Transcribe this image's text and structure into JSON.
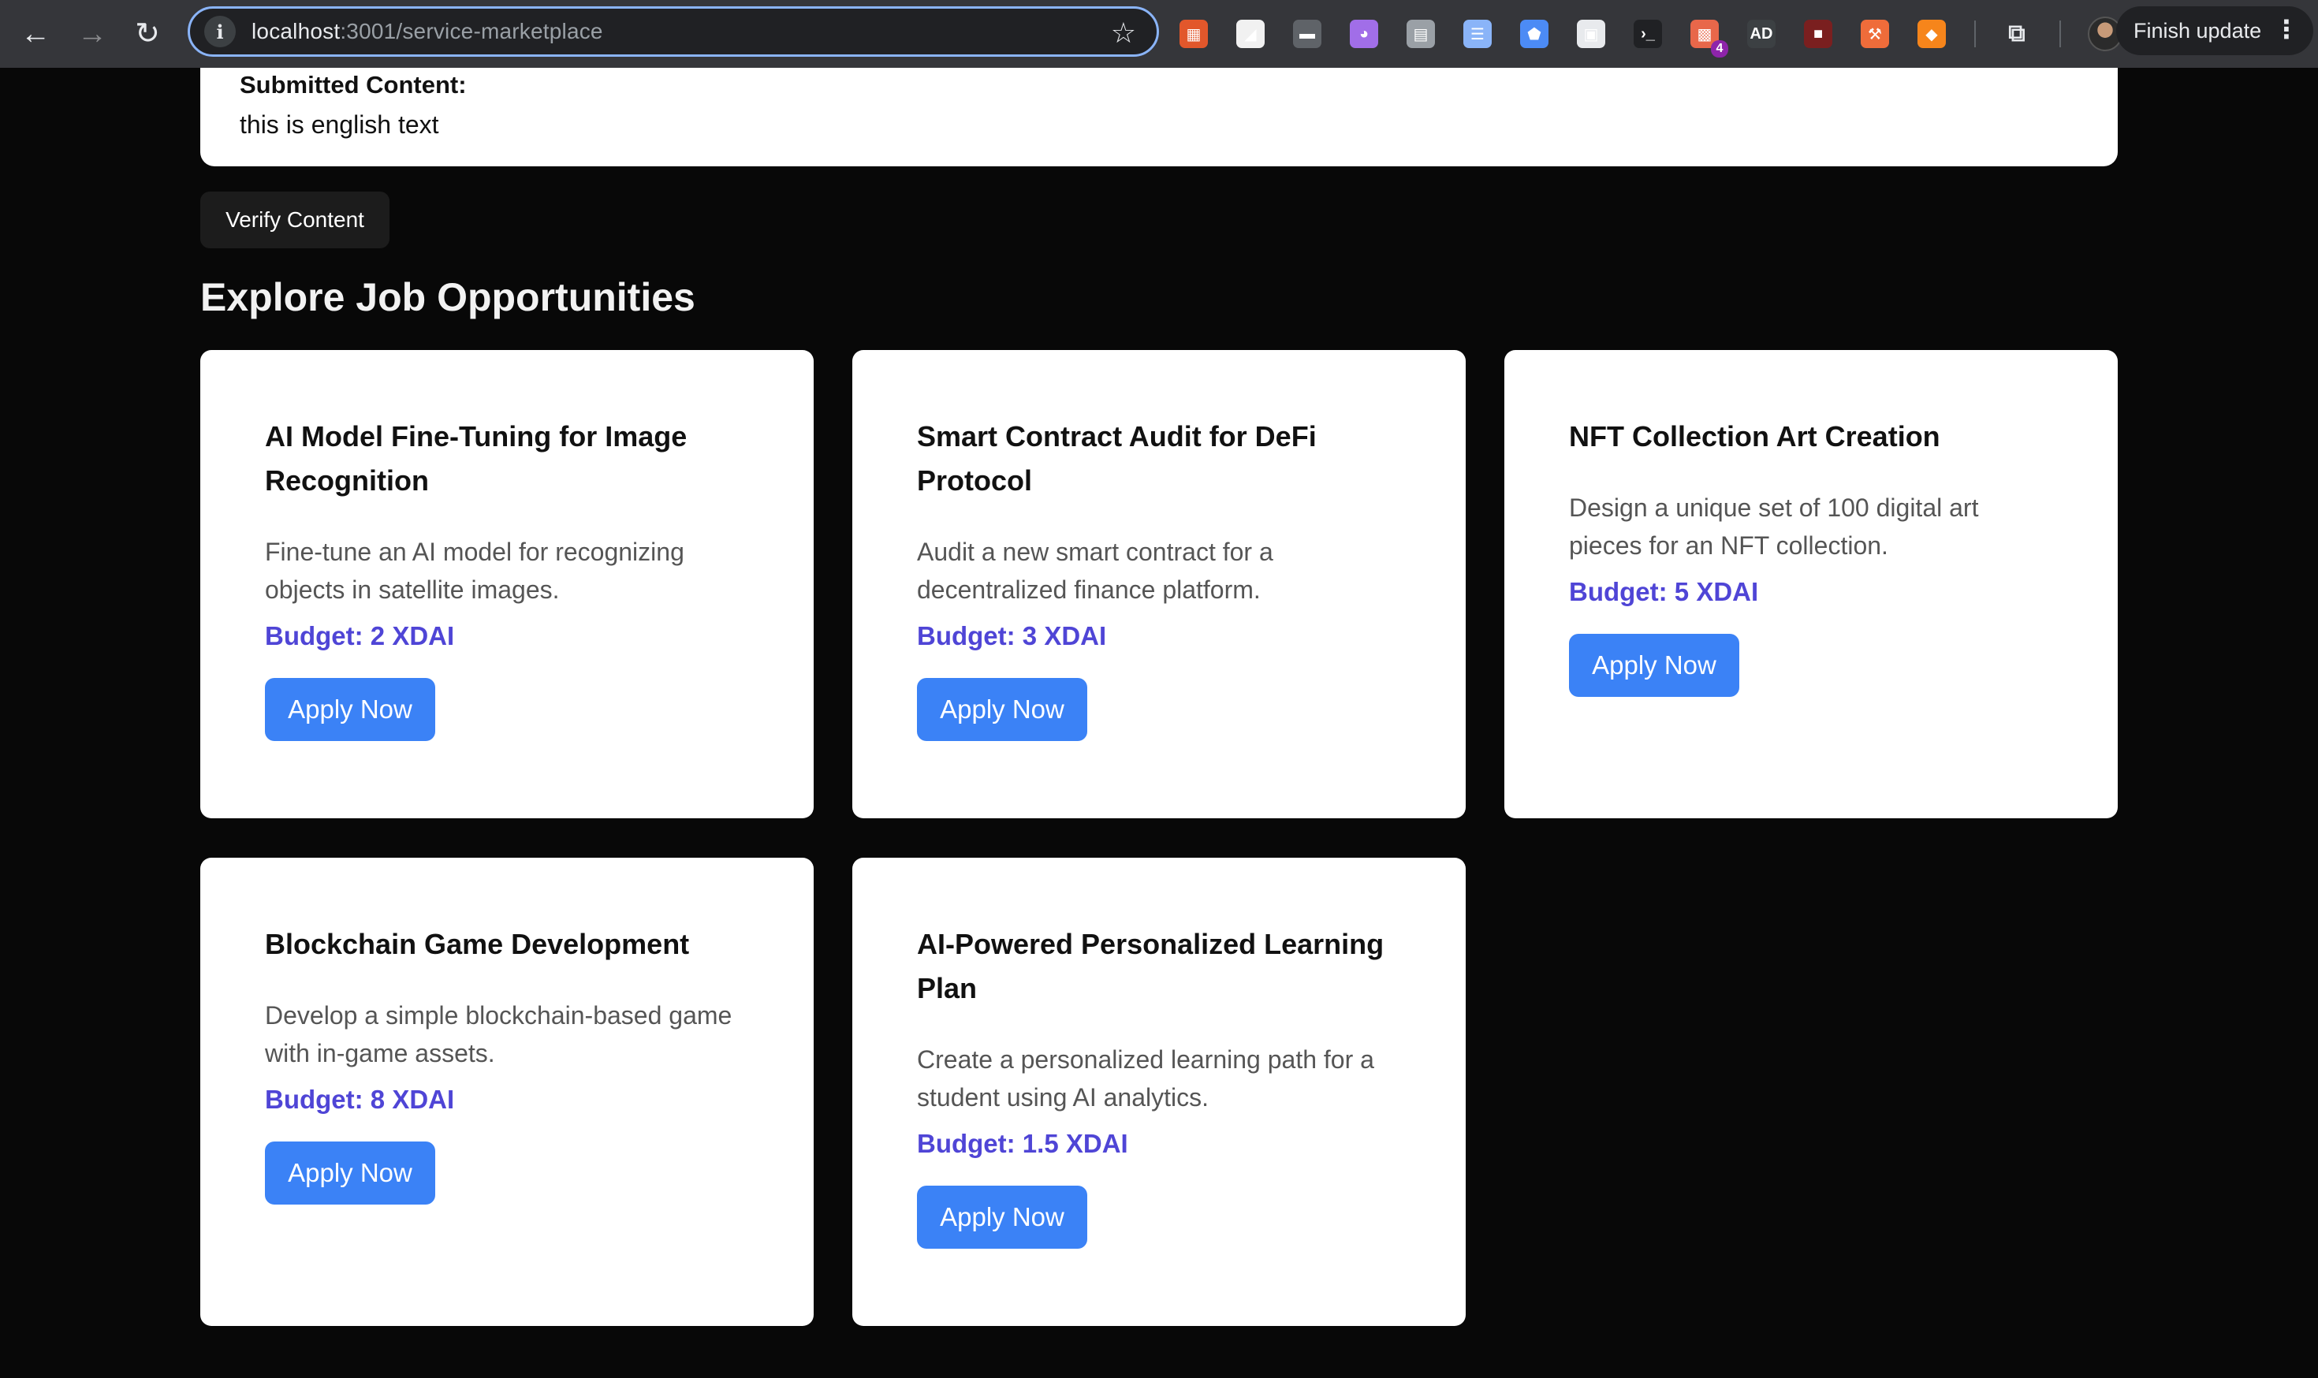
{
  "browser": {
    "url_host": "localhost",
    "url_path": ":3001/service-marketplace",
    "finish_update_label": "Finish update",
    "extensions": [
      {
        "name": "ext-red-icon",
        "color": "#e2572b",
        "glyph": "▦"
      },
      {
        "name": "ext-paper-plane-icon",
        "color": "#f1f1f1",
        "glyph": "◢"
      },
      {
        "name": "ext-folder-icon",
        "color": "#5f6368",
        "glyph": "▬"
      },
      {
        "name": "ext-purple-icon",
        "color": "#a16ee8",
        "glyph": "◕"
      },
      {
        "name": "ext-printer-icon",
        "color": "#9aa0a6",
        "glyph": "▤"
      },
      {
        "name": "ext-list-icon",
        "color": "#8ab4f8",
        "glyph": "☰"
      },
      {
        "name": "ext-shield-icon",
        "color": "#4c8bf5",
        "glyph": "⬟"
      },
      {
        "name": "ext-window-icon",
        "color": "#e8eaed",
        "glyph": "▣"
      },
      {
        "name": "ext-terminal-icon",
        "color": "#202124",
        "glyph": "›_"
      },
      {
        "name": "ext-badge-icon",
        "color": "#e8674a",
        "glyph": "▩",
        "badge": "4"
      },
      {
        "name": "ext-adtm-icon",
        "color": "#3c4043",
        "glyph": "AD"
      },
      {
        "name": "ext-dark-red-icon",
        "color": "#7a1f1f",
        "glyph": "■"
      },
      {
        "name": "ext-tool-icon",
        "color": "#ef6c3a",
        "glyph": "⚒"
      },
      {
        "name": "ext-fox-icon",
        "color": "#f6851b",
        "glyph": "◆"
      },
      {
        "name": "puzzle-icon",
        "color": "#35363a",
        "glyph": "⧉"
      }
    ]
  },
  "submitted": {
    "label": "Submitted Content:",
    "text": "this is english text"
  },
  "verify_button_label": "Verify Content",
  "section_title": "Explore Job Opportunities",
  "jobs": [
    {
      "title": "AI Model Fine-Tuning for Image Recognition",
      "description": "Fine-tune an AI model for recognizing objects in satellite images.",
      "budget": "Budget: 2 XDAI",
      "apply_label": "Apply Now"
    },
    {
      "title": "Smart Contract Audit for DeFi Protocol",
      "description": "Audit a new smart contract for a decentralized finance platform.",
      "budget": "Budget: 3 XDAI",
      "apply_label": "Apply Now"
    },
    {
      "title": "NFT Collection Art Creation",
      "description": "Design a unique set of 100 digital art pieces for an NFT collection.",
      "budget": "Budget: 5 XDAI",
      "apply_label": "Apply Now"
    },
    {
      "title": "Blockchain Game Development",
      "description": "Develop a simple blockchain-based game with in-game assets.",
      "budget": "Budget: 8 XDAI",
      "apply_label": "Apply Now"
    },
    {
      "title": "AI-Powered Personalized Learning Plan",
      "description": "Create a personalized learning path for a student using AI analytics.",
      "budget": "Budget: 1.5 XDAI",
      "apply_label": "Apply Now"
    }
  ],
  "colors": {
    "accent_button": "#3b82f6",
    "budget_text": "#4f45d6",
    "page_background": "#080808"
  }
}
